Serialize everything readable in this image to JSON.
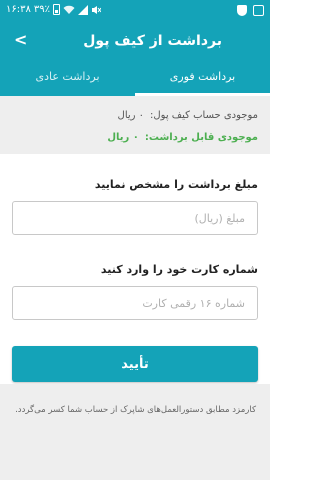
{
  "status_bar": {
    "time": "۱۶:۳۸",
    "battery_percent": "۳۹٪",
    "icons": [
      "battery-icon",
      "wifi-icon",
      "signal-icon",
      "mute-icon",
      "shield-icon",
      "image-icon"
    ]
  },
  "app_bar": {
    "title": "برداشت از کیف پول",
    "back_icon": "chevron-icon",
    "back_glyph": "<"
  },
  "tabs": [
    {
      "label": "برداشت فوری",
      "selected": true
    },
    {
      "label": "برداشت عادی",
      "selected": false
    }
  ],
  "balance": {
    "wallet_label": "موجودی حساب کیف پول:",
    "wallet_value": "۰ ریال",
    "withdrawable_label": "موجودی قابل برداشت:",
    "withdrawable_value": "۰ ریال"
  },
  "form": {
    "amount_label": "مبلغ برداشت را مشخص نمایید",
    "amount_placeholder": "مبلغ (ریال)",
    "card_label": "شماره کارت خود را وارد کنید",
    "card_placeholder": "شماره ۱۶ رقمی کارت",
    "submit_label": "تأیید"
  },
  "note": "کارمزد مطابق دستورالعمل‌های شاپرک از حساب شما کسر می‌گردد.",
  "colors": {
    "primary": "#14a3b8",
    "success": "#4caf50"
  }
}
